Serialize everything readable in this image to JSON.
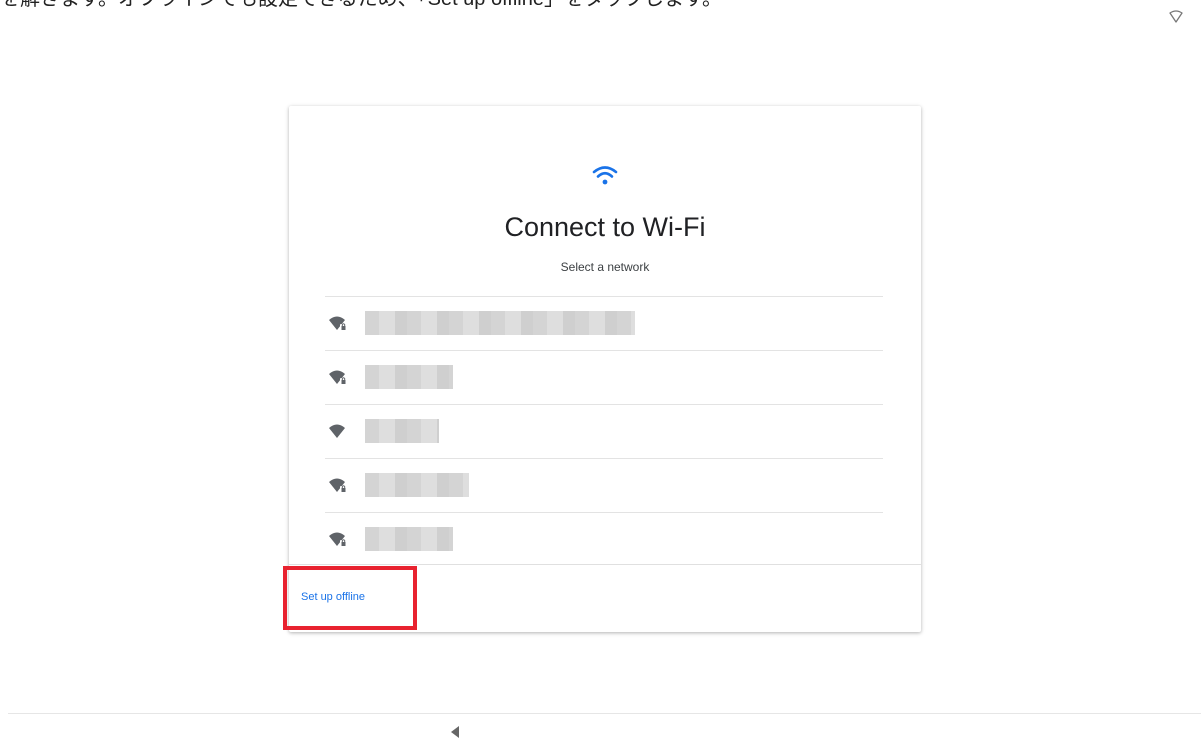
{
  "caption": {
    "text": "を解きます。オフラインでも設定できるため、「Set up offline」をタップします。"
  },
  "status_bar": {
    "wifi_icon": "wifi-outline-icon"
  },
  "card": {
    "header_icon": "wifi-icon",
    "title": "Connect to Wi-Fi",
    "subtitle": "Select a network",
    "networks": [
      {
        "name": "████████████",
        "icon": "wifi-locked-icon",
        "secured": true
      },
      {
        "name": "████",
        "icon": "wifi-locked-icon",
        "secured": true
      },
      {
        "name": "████",
        "icon": "wifi-icon",
        "secured": false
      },
      {
        "name": "█████",
        "icon": "wifi-locked-icon",
        "secured": true
      },
      {
        "name": "████",
        "icon": "wifi-locked-icon",
        "secured": true
      }
    ],
    "offline_label": "Set up offline"
  },
  "nav": {
    "back_icon": "back-triangle-icon"
  },
  "colors": {
    "accent": "#1a73e8",
    "highlight": "#e8222f",
    "icon_gray": "#5f6368"
  }
}
